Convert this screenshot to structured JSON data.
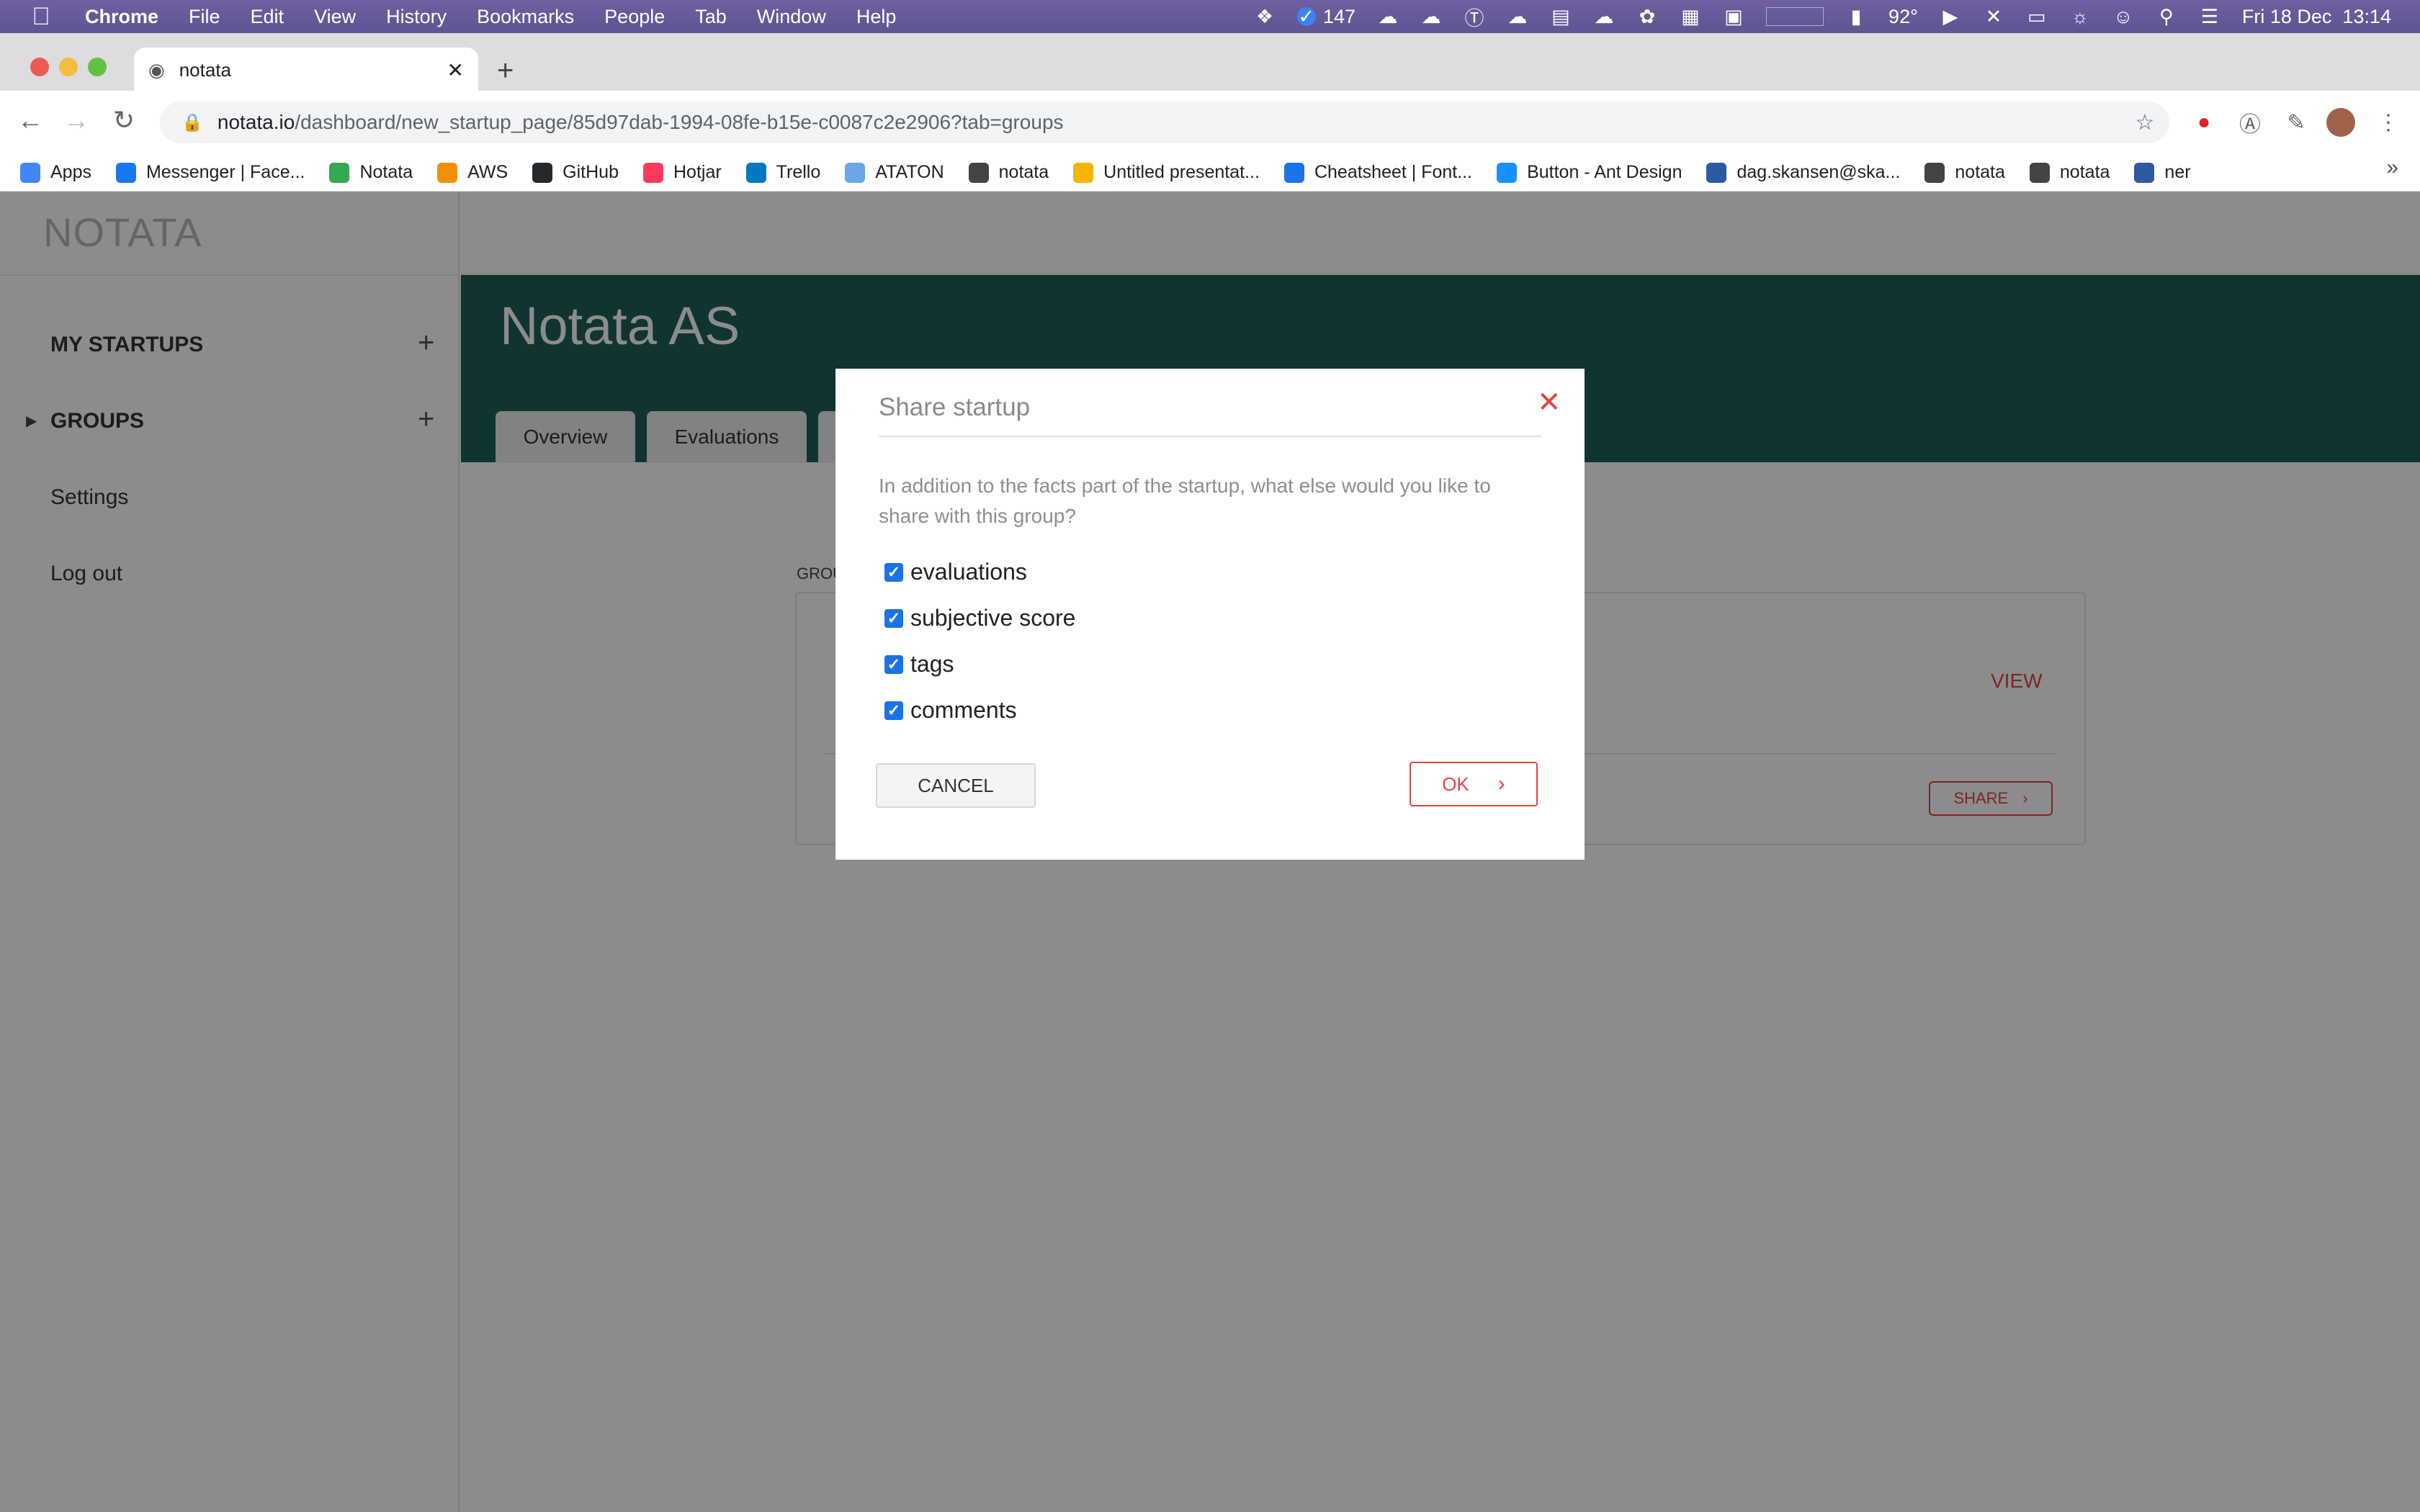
{
  "menubar": {
    "app": "Chrome",
    "items": [
      "File",
      "Edit",
      "View",
      "History",
      "Bookmarks",
      "People",
      "Tab",
      "Window",
      "Help"
    ],
    "status": {
      "notifications_count": "147",
      "temperature": "92°",
      "datetime": "Fri 18 Dec  13:14"
    }
  },
  "browser": {
    "tab_title": "notata",
    "url_host": "notata.io",
    "url_path": "/dashboard/new_startup_page/85d97dab-1994-08fe-b15e-c0087c2e2906?tab=groups",
    "bookmarks": [
      {
        "label": "Apps",
        "icon": "apps-grid-icon",
        "color": "#4285f4"
      },
      {
        "label": "Messenger | Face...",
        "icon": "facebook-icon",
        "color": "#1877f2"
      },
      {
        "label": "Notata",
        "icon": "google-drive-icon",
        "color": "#34a853"
      },
      {
        "label": "AWS",
        "icon": "aws-icon",
        "color": "#f29100"
      },
      {
        "label": "GitHub",
        "icon": "github-icon",
        "color": "#24292e"
      },
      {
        "label": "Hotjar",
        "icon": "hotjar-icon",
        "color": "#fd3a5c"
      },
      {
        "label": "Trello",
        "icon": "trello-icon",
        "color": "#0079bf"
      },
      {
        "label": "ATATON",
        "icon": "ataton-icon",
        "color": "#6aa6e8"
      },
      {
        "label": "notata",
        "icon": "globe-icon",
        "color": "#444444"
      },
      {
        "label": "Untitled presentat...",
        "icon": "slides-icon",
        "color": "#f4b400"
      },
      {
        "label": "Cheatsheet | Font...",
        "icon": "flag-icon",
        "color": "#1a73e8"
      },
      {
        "label": "Button - Ant Design",
        "icon": "ant-design-icon",
        "color": "#1890ff"
      },
      {
        "label": "dag.skansen@ska...",
        "icon": "database-icon",
        "color": "#2c5aa0"
      },
      {
        "label": "notata",
        "icon": "globe-icon",
        "color": "#444444"
      },
      {
        "label": "notata",
        "icon": "globe-icon",
        "color": "#444444"
      },
      {
        "label": "ner",
        "icon": "database-icon",
        "color": "#2c5aa0"
      }
    ]
  },
  "sidebar": {
    "logo": "NOTATA",
    "my_startups": "MY STARTUPS",
    "groups": "GROUPS",
    "settings": "Settings",
    "logout": "Log out"
  },
  "page": {
    "title": "Notata AS",
    "tabs": [
      "Overview",
      "Evaluations"
    ],
    "group_label": "GROU",
    "view_label": "VIEW",
    "share_label": "SHARE"
  },
  "modal": {
    "title": "Share startup",
    "description": "In addition to the facts part of the startup, what else would you like to share with this group?",
    "options": [
      {
        "label": "evaluations",
        "checked": true
      },
      {
        "label": "subjective score",
        "checked": true
      },
      {
        "label": "tags",
        "checked": true
      },
      {
        "label": "comments",
        "checked": true
      }
    ],
    "cancel_label": "CANCEL",
    "ok_label": "OK"
  },
  "colors": {
    "menubar": "#6a5c9c",
    "hero": "#1e5f5a",
    "accent": "#e0463f",
    "checkbox": "#1a73e8"
  }
}
